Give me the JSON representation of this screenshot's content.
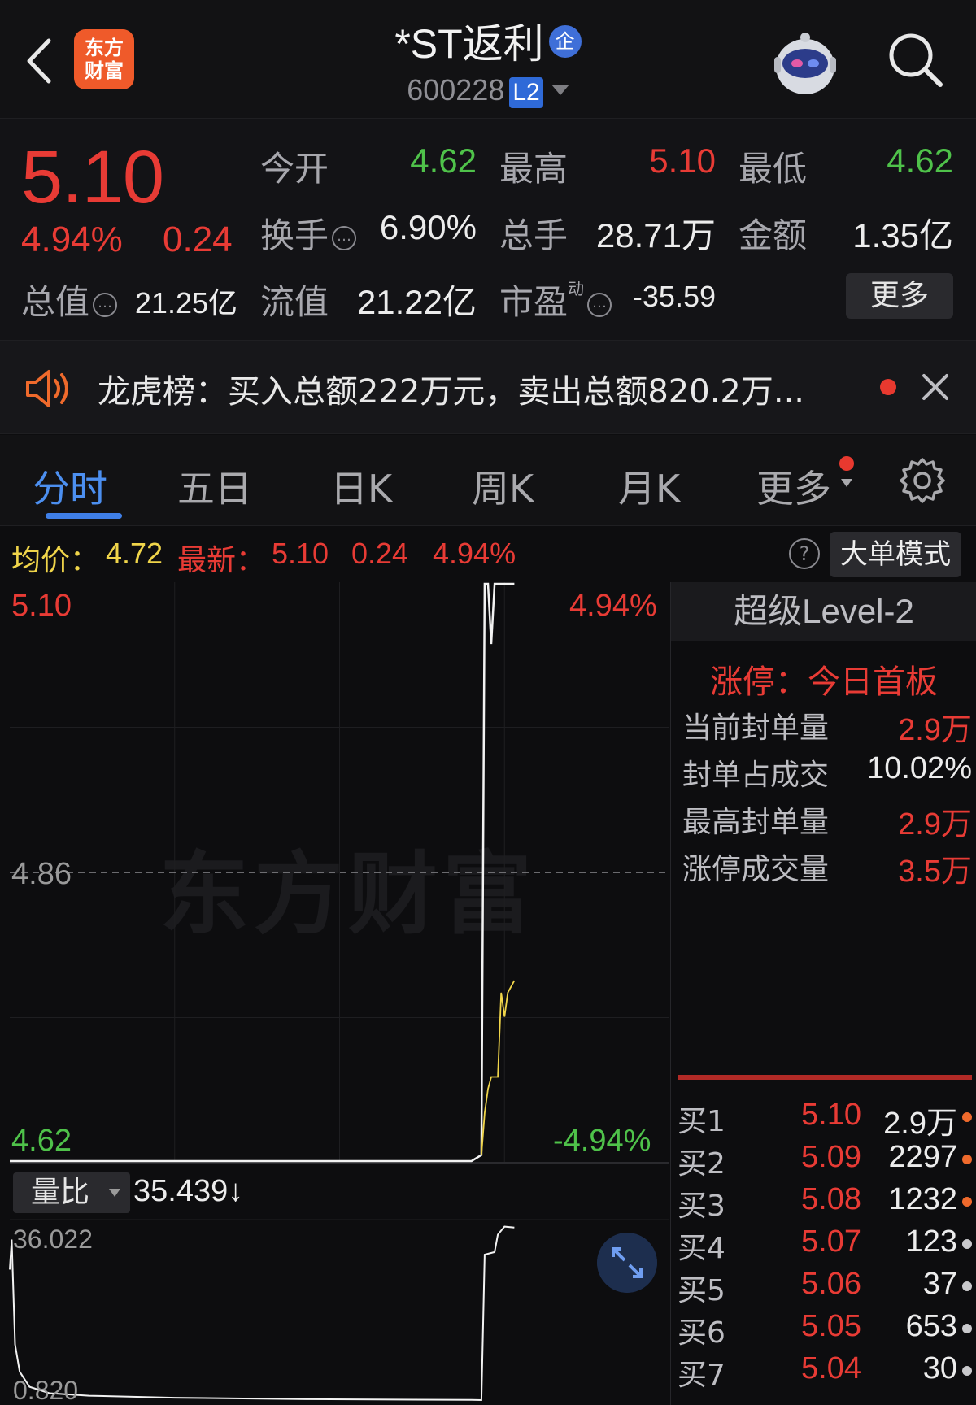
{
  "header": {
    "logo_line1": "东方",
    "logo_line2": "财富",
    "stock_name": "*ST返利",
    "badge": "企",
    "stock_code": "600228",
    "level_badge": "L2"
  },
  "quote": {
    "price": "5.10",
    "change_pct": "4.94%",
    "change": "0.24",
    "open_label": "今开",
    "open": "4.62",
    "high_label": "最高",
    "high": "5.10",
    "low_label": "最低",
    "low": "4.62",
    "turnover_label": "换手",
    "turnover": "6.90%",
    "volume_label": "总手",
    "volume": "28.71万",
    "amount_label": "金额",
    "amount": "1.35亿",
    "mktcap_label": "总值",
    "mktcap": "21.25亿",
    "float_label": "流值",
    "float_cap": "21.22亿",
    "pe_label": "市盈",
    "pe_sup": "动",
    "pe": "-35.59",
    "more_label": "更多"
  },
  "banner": {
    "text": "龙虎榜：买入总额222万元，卖出总额820.2万..."
  },
  "tabs": [
    {
      "label": "分时"
    },
    {
      "label": "五日"
    },
    {
      "label": "日K"
    },
    {
      "label": "周K"
    },
    {
      "label": "月K"
    },
    {
      "label": "更多"
    }
  ],
  "info_bar": {
    "avg_label": "均价：",
    "avg": "4.72",
    "latest_label": "最新：",
    "latest": "5.10",
    "change": "0.24",
    "change_pct": "4.94%",
    "help": "?",
    "big_order_label": "大单模式"
  },
  "chart_labels": {
    "y_top": "5.10",
    "y_mid": "4.86",
    "y_bottom": "4.62",
    "pct_top": "4.94%",
    "pct_bottom": "-4.94%",
    "watermark": "东方财富",
    "vr_select": "量比",
    "vr_value": "35.439↓",
    "vr_top": "36.022",
    "vr_bottom": "0.820"
  },
  "level2": {
    "title": "超级Level-2",
    "limit_title": "涨停：今日首板",
    "rows": [
      {
        "label": "当前封单量",
        "value": "2.9万"
      },
      {
        "label": "封单占成交",
        "value": "10.02%"
      },
      {
        "label": "最高封单量",
        "value": "2.9万"
      },
      {
        "label": "涨停成交量",
        "value": "3.5万"
      }
    ],
    "bids": [
      {
        "label": "买1",
        "price": "5.10",
        "volume": "2.9万"
      },
      {
        "label": "买2",
        "price": "5.09",
        "volume": "2297"
      },
      {
        "label": "买3",
        "price": "5.08",
        "volume": "1232"
      },
      {
        "label": "买4",
        "price": "5.07",
        "volume": "123"
      },
      {
        "label": "买5",
        "price": "5.06",
        "volume": "37"
      },
      {
        "label": "买6",
        "price": "5.05",
        "volume": "653"
      },
      {
        "label": "买7",
        "price": "5.04",
        "volume": "30"
      }
    ]
  },
  "colors": {
    "up": "#e83b35",
    "down": "#4fc24a",
    "price_line": "#f2f2f2",
    "avg_line": "#f0d54a",
    "accent": "#3f7fe8"
  },
  "chart_data": {
    "type": "line",
    "ylim": [
      4.62,
      5.1
    ],
    "pct_range": [
      -4.94,
      4.94
    ],
    "series": [
      {
        "points": [
          [
            0,
            4.62
          ],
          [
            0.42,
            4.62
          ],
          [
            0.7,
            4.62
          ],
          [
            0.715,
            4.625
          ],
          [
            0.72,
            5.1
          ],
          [
            0.725,
            5.1
          ],
          [
            0.73,
            5.05
          ],
          [
            0.735,
            5.1
          ],
          [
            0.765,
            5.1
          ]
        ]
      },
      {
        "points": [
          [
            0.715,
            4.625
          ],
          [
            0.72,
            4.66
          ],
          [
            0.725,
            4.68
          ],
          [
            0.73,
            4.69
          ],
          [
            0.74,
            4.69
          ],
          [
            0.745,
            4.76
          ],
          [
            0.75,
            4.74
          ],
          [
            0.755,
            4.76
          ],
          [
            0.765,
            4.77
          ]
        ]
      }
    ],
    "volume_ratio": {
      "ylim": [
        0.82,
        36.022
      ],
      "points": [
        [
          0,
          27
        ],
        [
          0.003,
          33
        ],
        [
          0.008,
          12
        ],
        [
          0.015,
          6.5
        ],
        [
          0.03,
          3.5
        ],
        [
          0.06,
          2.2
        ],
        [
          0.12,
          1.7
        ],
        [
          0.25,
          1.3
        ],
        [
          0.45,
          1.0
        ],
        [
          0.7,
          0.85
        ],
        [
          0.715,
          0.82
        ],
        [
          0.72,
          30
        ],
        [
          0.735,
          30.5
        ],
        [
          0.74,
          34
        ],
        [
          0.75,
          35.6
        ],
        [
          0.765,
          35.4
        ]
      ]
    }
  }
}
